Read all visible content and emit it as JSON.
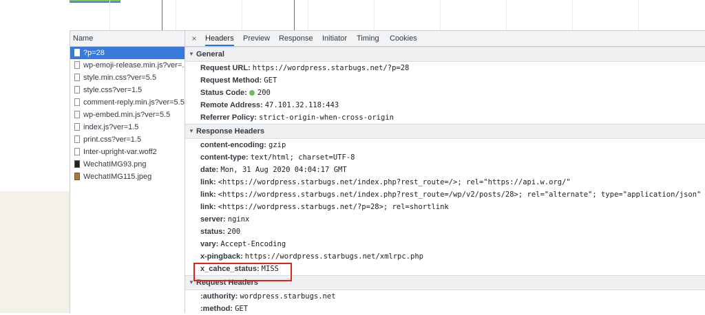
{
  "name_panel": {
    "header": "Name",
    "rows": [
      {
        "name": "?p=28",
        "type": "doc",
        "selected": true
      },
      {
        "name": "wp-emoji-release.min.js?ver=...",
        "type": "doc",
        "selected": false
      },
      {
        "name": "style.min.css?ver=5.5",
        "type": "doc",
        "selected": false
      },
      {
        "name": "style.css?ver=1.5",
        "type": "doc",
        "selected": false
      },
      {
        "name": "comment-reply.min.js?ver=5.5",
        "type": "doc",
        "selected": false
      },
      {
        "name": "wp-embed.min.js?ver=5.5",
        "type": "doc",
        "selected": false
      },
      {
        "name": "index.js?ver=1.5",
        "type": "doc",
        "selected": false
      },
      {
        "name": "print.css?ver=1.5",
        "type": "doc",
        "selected": false
      },
      {
        "name": "Inter-upright-var.woff2",
        "type": "doc",
        "selected": false
      },
      {
        "name": "WechatIMG93.png",
        "type": "img",
        "selected": false
      },
      {
        "name": "WechatIMG115.jpeg",
        "type": "img2",
        "selected": false
      }
    ]
  },
  "tabs": {
    "close_glyph": "×",
    "items": [
      "Headers",
      "Preview",
      "Response",
      "Initiator",
      "Timing",
      "Cookies"
    ],
    "active": "Headers"
  },
  "general": {
    "title": "General",
    "rows": [
      {
        "key": "Request URL:",
        "value": "https://wordpress.starbugs.net/?p=28"
      },
      {
        "key": "Request Method:",
        "value": "GET"
      },
      {
        "key": "Status Code:",
        "value": "200",
        "dot": true
      },
      {
        "key": "Remote Address:",
        "value": "47.101.32.118:443"
      },
      {
        "key": "Referrer Policy:",
        "value": "strict-origin-when-cross-origin"
      }
    ]
  },
  "response_headers": {
    "title": "Response Headers",
    "rows": [
      {
        "key": "content-encoding:",
        "value": "gzip"
      },
      {
        "key": "content-type:",
        "value": "text/html; charset=UTF-8"
      },
      {
        "key": "date:",
        "value": "Mon, 31 Aug 2020 04:04:17 GMT"
      },
      {
        "key": "link:",
        "value": "<https://wordpress.starbugs.net/index.php?rest_route=/>; rel=\"https://api.w.org/\""
      },
      {
        "key": "link:",
        "value": "<https://wordpress.starbugs.net/index.php?rest_route=/wp/v2/posts/28>; rel=\"alternate\"; type=\"application/json\""
      },
      {
        "key": "link:",
        "value": "<https://wordpress.starbugs.net/?p=28>; rel=shortlink"
      },
      {
        "key": "server:",
        "value": "nginx"
      },
      {
        "key": "status:",
        "value": "200"
      },
      {
        "key": "vary:",
        "value": "Accept-Encoding"
      },
      {
        "key": "x-pingback:",
        "value": "https://wordpress.starbugs.net/xmlrpc.php"
      },
      {
        "key": "x_cahce_status:",
        "value": "MISS",
        "highlighted": true
      }
    ]
  },
  "request_headers": {
    "title": "Request Headers",
    "rows": [
      {
        "key": ":authority:",
        "value": "wordpress.starbugs.net"
      },
      {
        "key": ":method:",
        "value": "GET"
      }
    ]
  },
  "colors": {
    "selected_row": "#3879d9",
    "active_tab": "#1a73e8",
    "highlight_box": "#e0221b",
    "status_ok": "#6dbb5d"
  }
}
